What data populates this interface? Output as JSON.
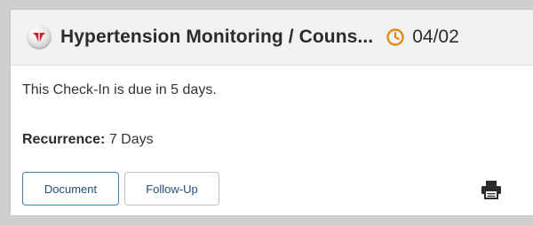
{
  "card": {
    "title": "Hypertension Monitoring / Couns...",
    "due_date": "04/02",
    "due_message": "This Check-In is due in 5 days.",
    "recurrence_label": "Recurrence:",
    "recurrence_value": "7 Days",
    "buttons": {
      "document": "Document",
      "follow_up": "Follow-Up"
    }
  },
  "icons": {
    "logo": "caduceus-logo",
    "clock": "clock-icon",
    "print": "print-icon"
  },
  "colors": {
    "clock_orange": "#e08a1e",
    "logo_red": "#c8202b",
    "button_text": "#1f4f77",
    "active_button_border": "#3f7fa8"
  }
}
